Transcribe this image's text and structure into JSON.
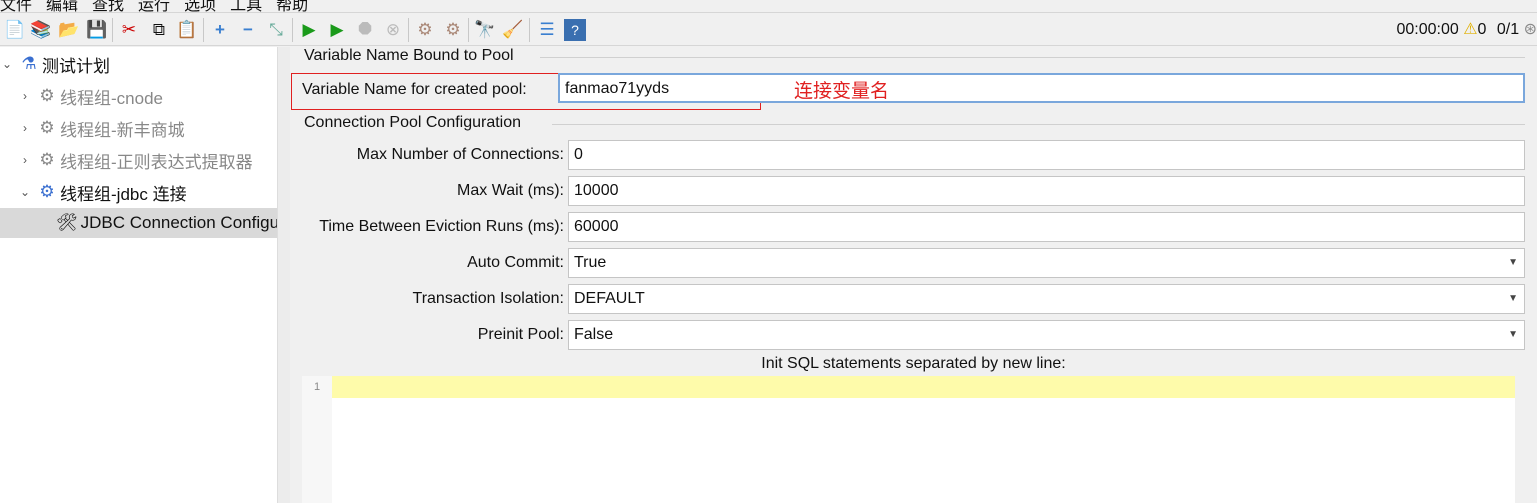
{
  "menu": [
    "文件",
    "编辑",
    "查找",
    "运行",
    "选项",
    "工具",
    "帮助"
  ],
  "toolbar": {
    "icons": [
      "new-icon",
      "templates-icon",
      "open-icon",
      "save-icon",
      "cut-icon",
      "copy-icon",
      "paste-icon",
      "expand-icon",
      "collapse-icon",
      "toggle-icon",
      "start-icon",
      "start-no-pause-icon",
      "stop-icon",
      "shutdown-icon",
      "clear-icon",
      "clear-all-icon",
      "search-icon",
      "reset-search-icon",
      "function-helper-icon",
      "help-icon"
    ]
  },
  "status": {
    "timer": "00:00:00",
    "warnings": "0",
    "threads": "0/1"
  },
  "tree": {
    "root": "测试计划",
    "items": [
      {
        "label": "线程组-cnode",
        "disabled": true
      },
      {
        "label": "线程组-新丰商城",
        "disabled": true
      },
      {
        "label": "线程组-正则表达式提取器",
        "disabled": true
      },
      {
        "label": "线程组-jdbc 连接",
        "disabled": false
      },
      {
        "label": "JDBC Connection Configu",
        "selected": true
      }
    ]
  },
  "form": {
    "bound_section": "Variable Name Bound to Pool",
    "var_label": "Variable Name for created pool:",
    "var_value": "fanmao71yyds",
    "annotation": "连接变量名",
    "pool_section": "Connection Pool Configuration",
    "rows": [
      {
        "label": "Max Number of Connections:",
        "value": "0"
      },
      {
        "label": "Max Wait (ms):",
        "value": "10000"
      },
      {
        "label": "Time Between Eviction Runs (ms):",
        "value": "60000"
      },
      {
        "label": "Auto Commit:",
        "value": "True"
      },
      {
        "label": "Transaction Isolation:",
        "value": "DEFAULT"
      },
      {
        "label": "Preinit Pool:",
        "value": "False"
      }
    ],
    "init_sql_label": "Init SQL statements separated by new line:",
    "line_number": "1"
  }
}
